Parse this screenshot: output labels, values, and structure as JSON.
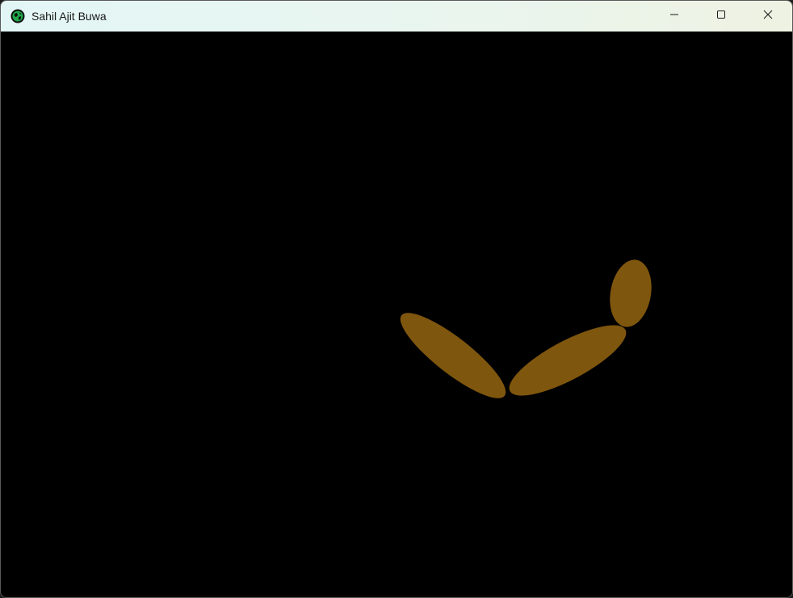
{
  "window": {
    "title": "Sahil Ajit Buwa",
    "icon": "green-globe-icon"
  },
  "caption_buttons": {
    "minimize": "minimize-icon",
    "maximize": "maximize-icon",
    "close": "close-icon"
  },
  "scene": {
    "background_color": "#000000",
    "shape_color": "#7f560e",
    "shapes": [
      "left-arm-ellipse",
      "right-arm-ellipse",
      "head-ellipse"
    ]
  }
}
